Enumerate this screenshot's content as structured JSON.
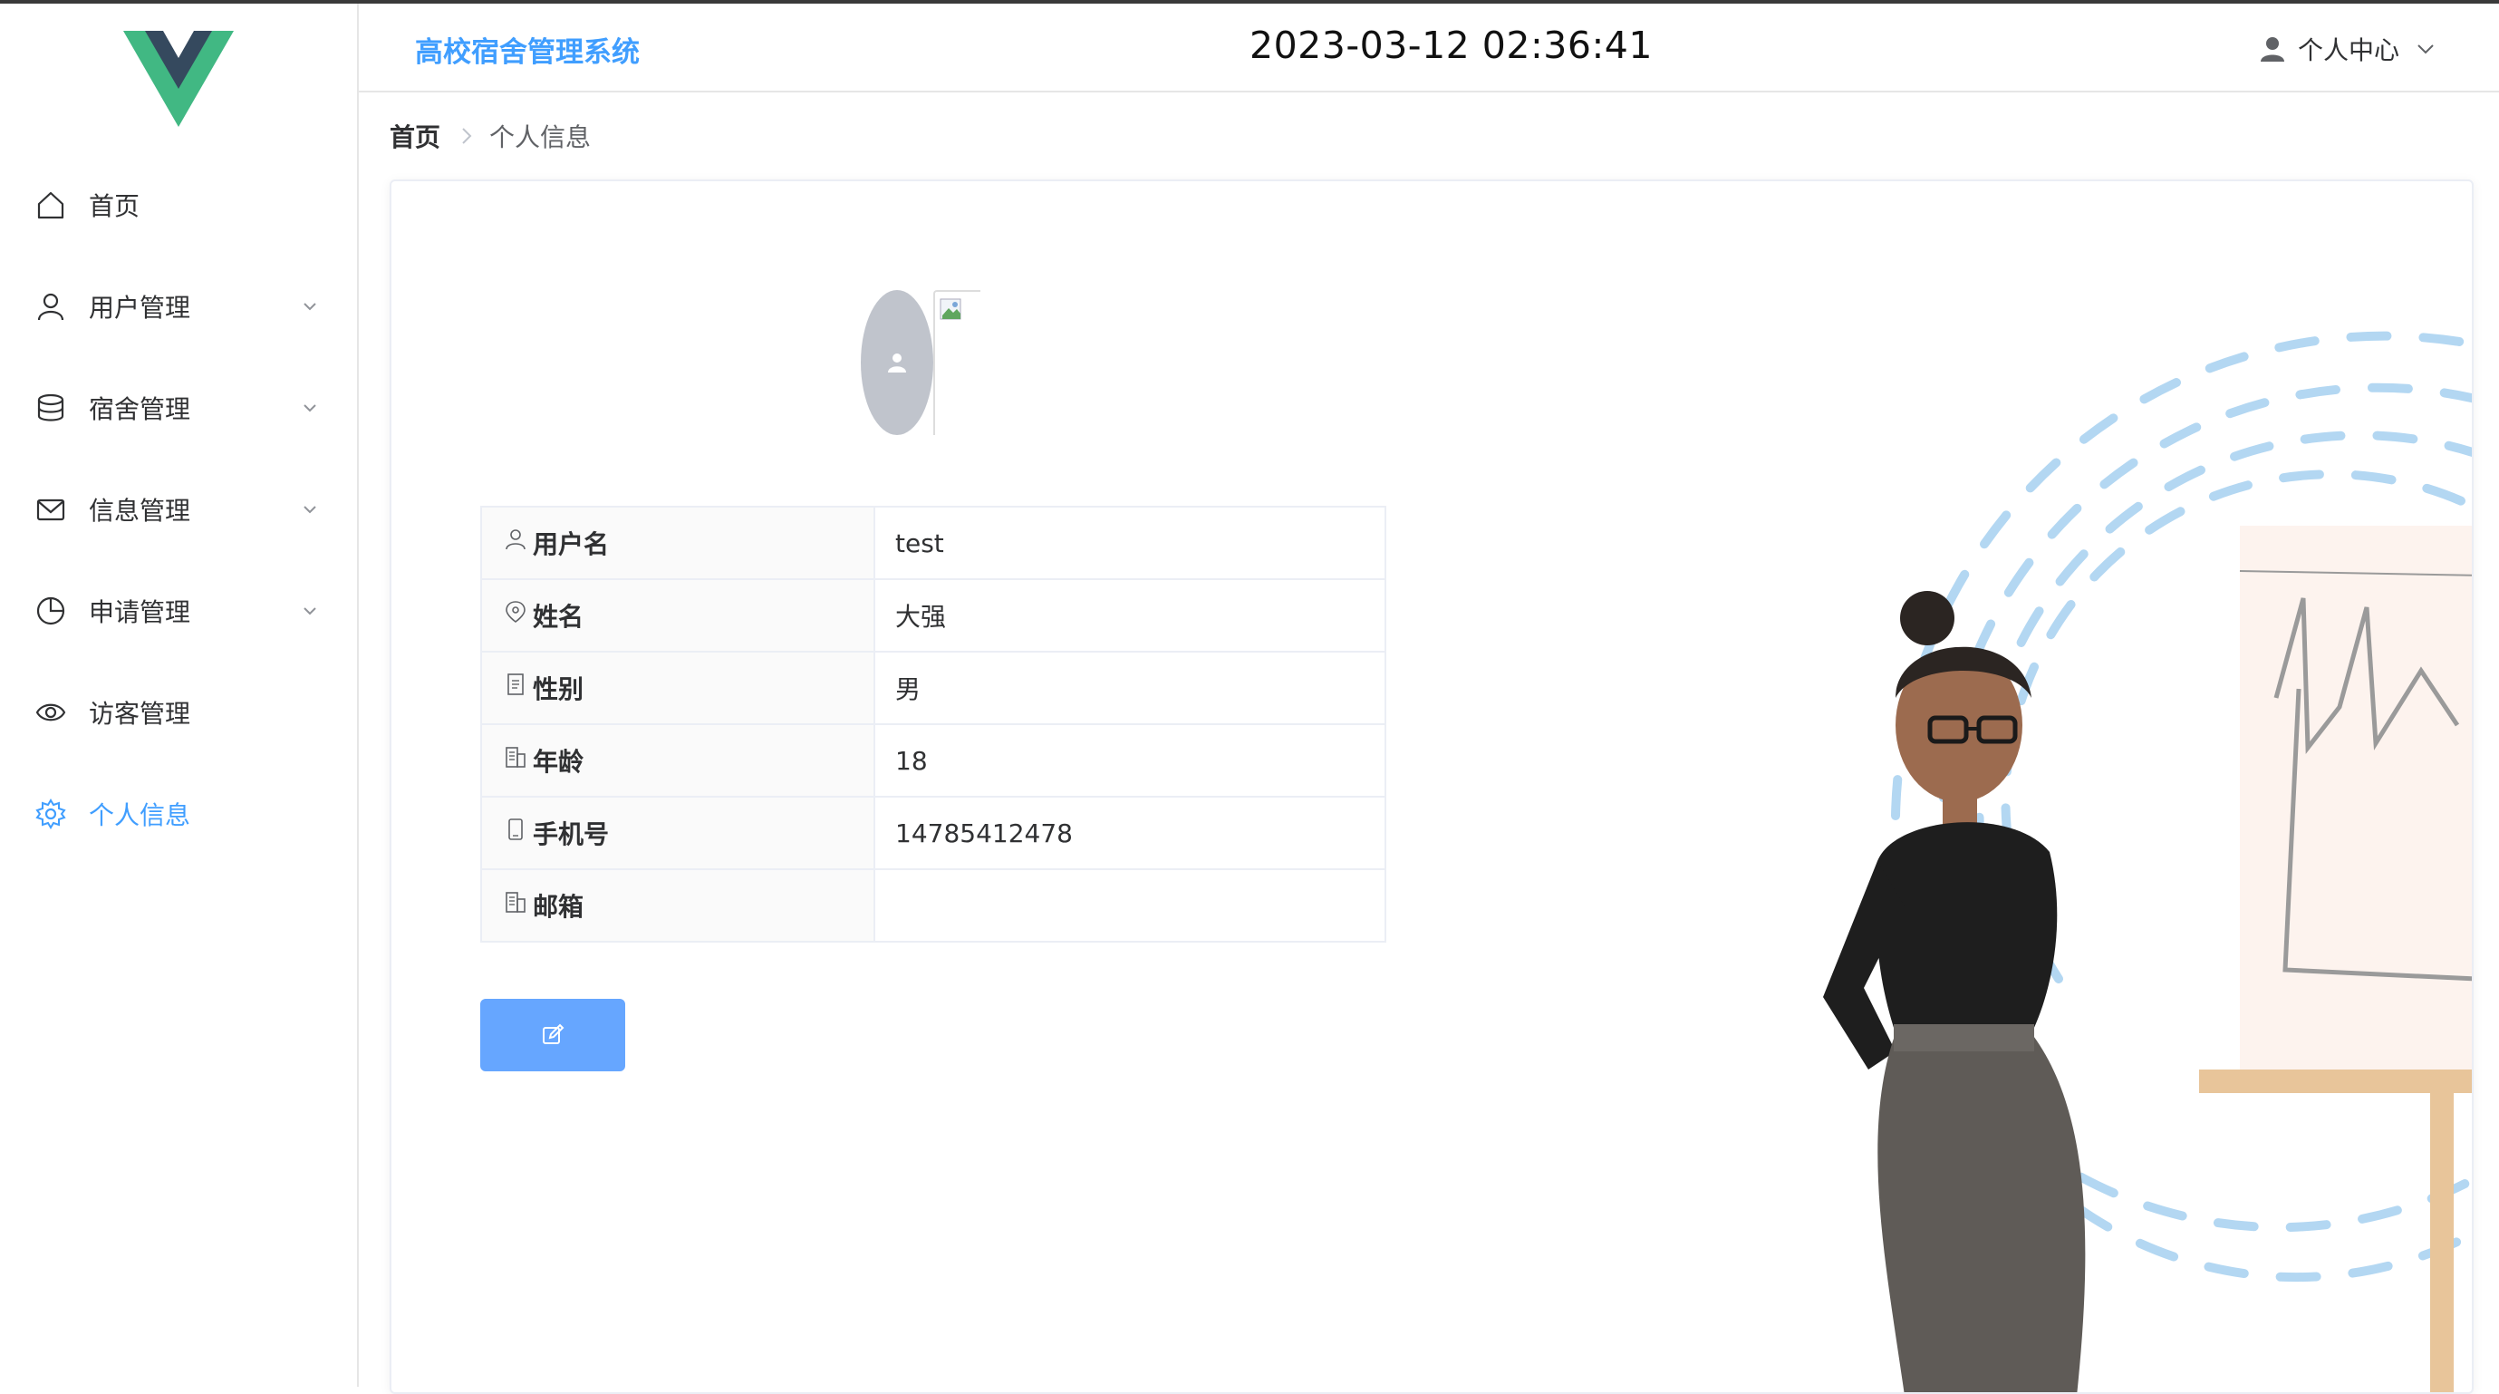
{
  "app": {
    "title": "高校宿舍管理系统",
    "clock": "2023-03-12 02:36:41",
    "user_menu_label": "个人中心",
    "accent_color": "#409eff"
  },
  "sidebar": {
    "items": [
      {
        "label": "首页",
        "icon": "home-icon",
        "has_submenu": false,
        "active": false
      },
      {
        "label": "用户管理",
        "icon": "user-icon",
        "has_submenu": true,
        "active": false
      },
      {
        "label": "宿舍管理",
        "icon": "database-icon",
        "has_submenu": true,
        "active": false
      },
      {
        "label": "信息管理",
        "icon": "message-icon",
        "has_submenu": true,
        "active": false
      },
      {
        "label": "申请管理",
        "icon": "pie-chart-icon",
        "has_submenu": true,
        "active": false
      },
      {
        "label": "访客管理",
        "icon": "eye-icon",
        "has_submenu": false,
        "active": false
      },
      {
        "label": "个人信息",
        "icon": "setting-icon",
        "has_submenu": false,
        "active": true
      }
    ]
  },
  "breadcrumb": {
    "home": "首页",
    "current": "个人信息"
  },
  "profile": {
    "rows": [
      {
        "label": "用户名",
        "icon": "user-icon",
        "value": "test"
      },
      {
        "label": "姓名",
        "icon": "location-icon",
        "value": "大强"
      },
      {
        "label": "性别",
        "icon": "document-icon",
        "value": "男"
      },
      {
        "label": "年龄",
        "icon": "office-building-icon",
        "value": "18"
      },
      {
        "label": "手机号",
        "icon": "mobile-icon",
        "value": "14785412478"
      },
      {
        "label": "邮箱",
        "icon": "office-building-icon",
        "value": ""
      }
    ],
    "edit_button_icon": "edit-icon"
  }
}
